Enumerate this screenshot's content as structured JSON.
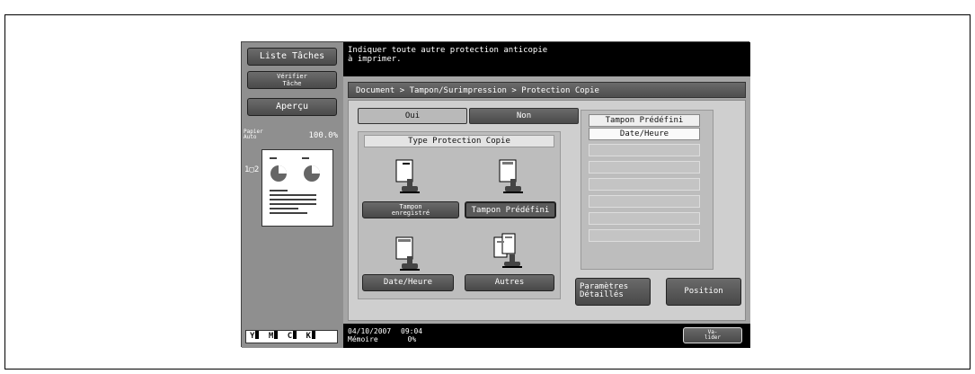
{
  "left": {
    "jobs_list": "Liste Tâches",
    "check_job_line1": "Vérifier",
    "check_job_line2": "Tâche",
    "preview": "Aperçu",
    "paper_label": "Papier Auto",
    "zoom": "100.0%",
    "duplex": "1▢2",
    "toner": [
      "Y",
      "M",
      "C",
      "K"
    ]
  },
  "message": {
    "line1": "Indiquer toute autre protection anticopie",
    "line2": "à imprimer."
  },
  "breadcrumb": "Document  >  Tampon/Surimpression > Protection Copie",
  "toggle": {
    "yes": "Oui",
    "no": "Non",
    "selected": "Oui"
  },
  "type_section": {
    "title": "Type Protection Copie",
    "buttons": [
      {
        "line1": "Tampon",
        "line2": "enregistré"
      },
      {
        "label": "Tampon Prédéfini"
      },
      {
        "label": "Date/Heure"
      },
      {
        "label": "Autres"
      }
    ]
  },
  "stamp_list": {
    "header": "Tampon Prédéfini",
    "selected": "Date/Heure",
    "empty_slots": 6
  },
  "actions": {
    "details_line1": "Paramètres",
    "details_line2": "Détaillés",
    "position": "Position",
    "validate_line1": "Va-",
    "validate_line2": "lider"
  },
  "status": {
    "date": "04/10/2007",
    "time": "09:04",
    "memory_label": "Mémoire",
    "memory_value": "0%"
  },
  "colors": {
    "dark_button": "#4a4a4a",
    "screen_bg": "#9a9a9a",
    "panel_bg": "#cfcfcf",
    "message_bg": "#000000"
  }
}
